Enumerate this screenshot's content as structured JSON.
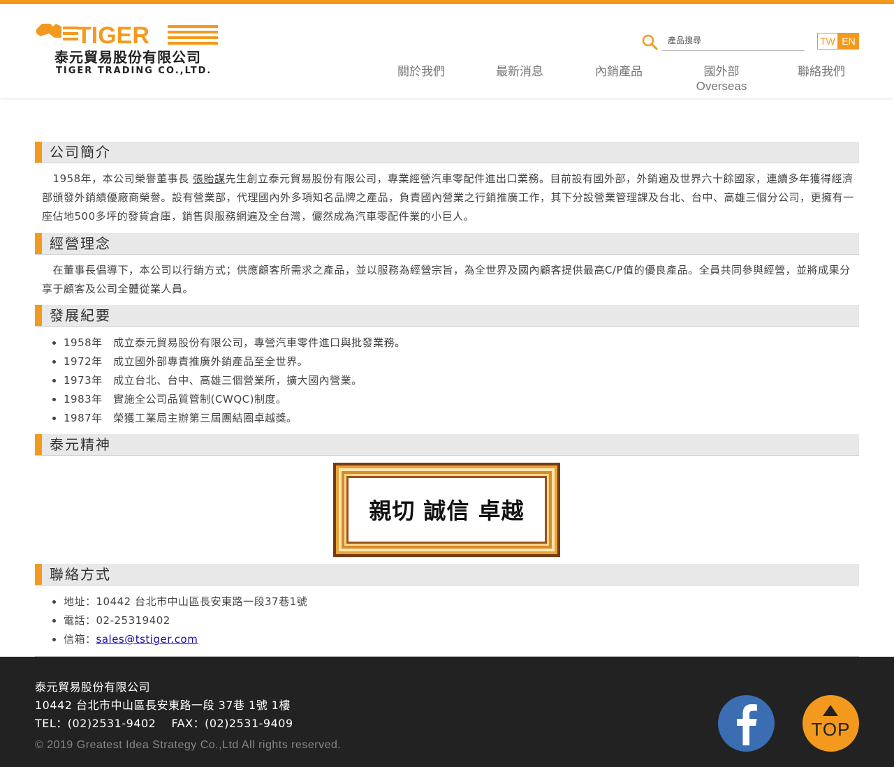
{
  "brand": {
    "logo_word": "TIGER",
    "name_cn": "泰元貿易股份有限公司",
    "name_en": "TIGER TRADING CO.,LTD.",
    "accent_color": "#f39a1e"
  },
  "header": {
    "search_placeholder": "產品搜尋",
    "lang_tw": "TW",
    "lang_en": "EN",
    "nav": [
      {
        "label": "關於我們"
      },
      {
        "label": "最新消息"
      },
      {
        "label": "內銷產品"
      },
      {
        "label": "國外部",
        "sub": "Overseas"
      },
      {
        "label": "聯絡我們"
      }
    ]
  },
  "sections": {
    "intro": {
      "title": "公司簡介",
      "text_1": "　1958年，本公司榮譽董事長 ",
      "link": "張貽謀",
      "text_2": "先生創立泰元貿易股份有限公司，專業經營汽車零配件進出口業務。目前設有國外部，外銷遍及世界六十餘國家，連續多年獲得經濟部頒發外銷績優廠商榮譽。設有營業部，代理國內外多項知名品牌之產品，負責國內營業之行銷推廣工作，其下分設營業管理課及台北、台中、高雄三個分公司，更擁有一座佔地500多坪的發貨倉庫，銷售與服務網遍及全台灣，儼然成為汽車零配件業的小巨人。"
    },
    "philosophy": {
      "title": "經營理念",
      "text": "　在董事長倡導下，本公司以行銷方式；供應顧客所需求之產品，並以服務為經營宗旨，為全世界及國內顧客提供最高C/P值的優良產品。全員共同參與經營，並將成果分享于顧客及公司全體從業人員。"
    },
    "history": {
      "title": "發展紀要",
      "items": [
        "1958年　成立泰元貿易股份有限公司，專營汽車零件進口與批發業務。",
        "1972年　成立國外部專責推廣外銷產品至全世界。",
        "1973年　成立台北、台中、高雄三個營業所，擴大國內營業。",
        "1983年　實施全公司品質管制(CWQC)制度。",
        "1987年　榮獲工業局主辦第三屆團結圈卓越獎。"
      ]
    },
    "spirit": {
      "title": "泰元精神",
      "plaque_text": "親切 誠信 卓越"
    },
    "contact": {
      "title": "聯絡方式",
      "address": "地址：10442 台北市中山區長安東路一段37巷1號",
      "phone": "電話：02-25319402",
      "email_label": "信箱：",
      "email": "sales@tstiger.com"
    }
  },
  "footer": {
    "company": "泰元貿易股份有限公司",
    "address": "10442 台北市中山區長安東路一段 37巷 1號 1樓",
    "tel_fax": "TEL：(02)2531-9402　 FAX：(02)2531-9409",
    "copyright": "© 2019 Greatest Idea Strategy Co.,Ltd All rights reserved.",
    "top_label": "TOP",
    "facebook_color": "#3b6db3"
  }
}
